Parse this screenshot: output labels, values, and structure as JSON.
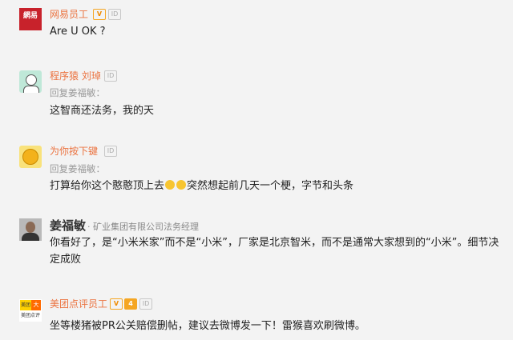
{
  "comments": [
    {
      "name": "网易员工",
      "avatar_text": "網易",
      "badge": "V",
      "id_label": "ID",
      "text": "Are U OK ?"
    },
    {
      "name": "程序猿 刘琸",
      "id_label": "ID",
      "reply_to": "回复姜福敏：",
      "text": "这智商还法务，我的天"
    },
    {
      "name": "为你按下键",
      "id_label": "ID",
      "reply_to": "回复姜福敏：",
      "text_a": "打算给你这个憨憨顶上去",
      "text_b": "突然想起前几天一个梗，字节和头条"
    },
    {
      "name": "姜福敏",
      "title": "· 矿业集团有限公司法务经理",
      "text": "你看好了，是“小米米家”而不是“小米”，厂家是北京智米，而不是通常大家想到的“小米”。细节决定成败"
    },
    {
      "name": "美团点评员工",
      "avatar_text_top": "美团",
      "avatar_text_right": "大",
      "avatar_text_bottom": "美团点评",
      "badge": "V",
      "badge2": "4",
      "id_label": "ID",
      "text": "坐等楼猪被PR公关赔偿删帖，建议去微博发一下！雷猴喜欢刷微博。"
    }
  ],
  "colors": {
    "background": "#f3f3f3",
    "name": "#eb7340",
    "badge": "#f5a623",
    "netease_red": "#c8222b",
    "meituan_orange": "#ff8c00"
  }
}
